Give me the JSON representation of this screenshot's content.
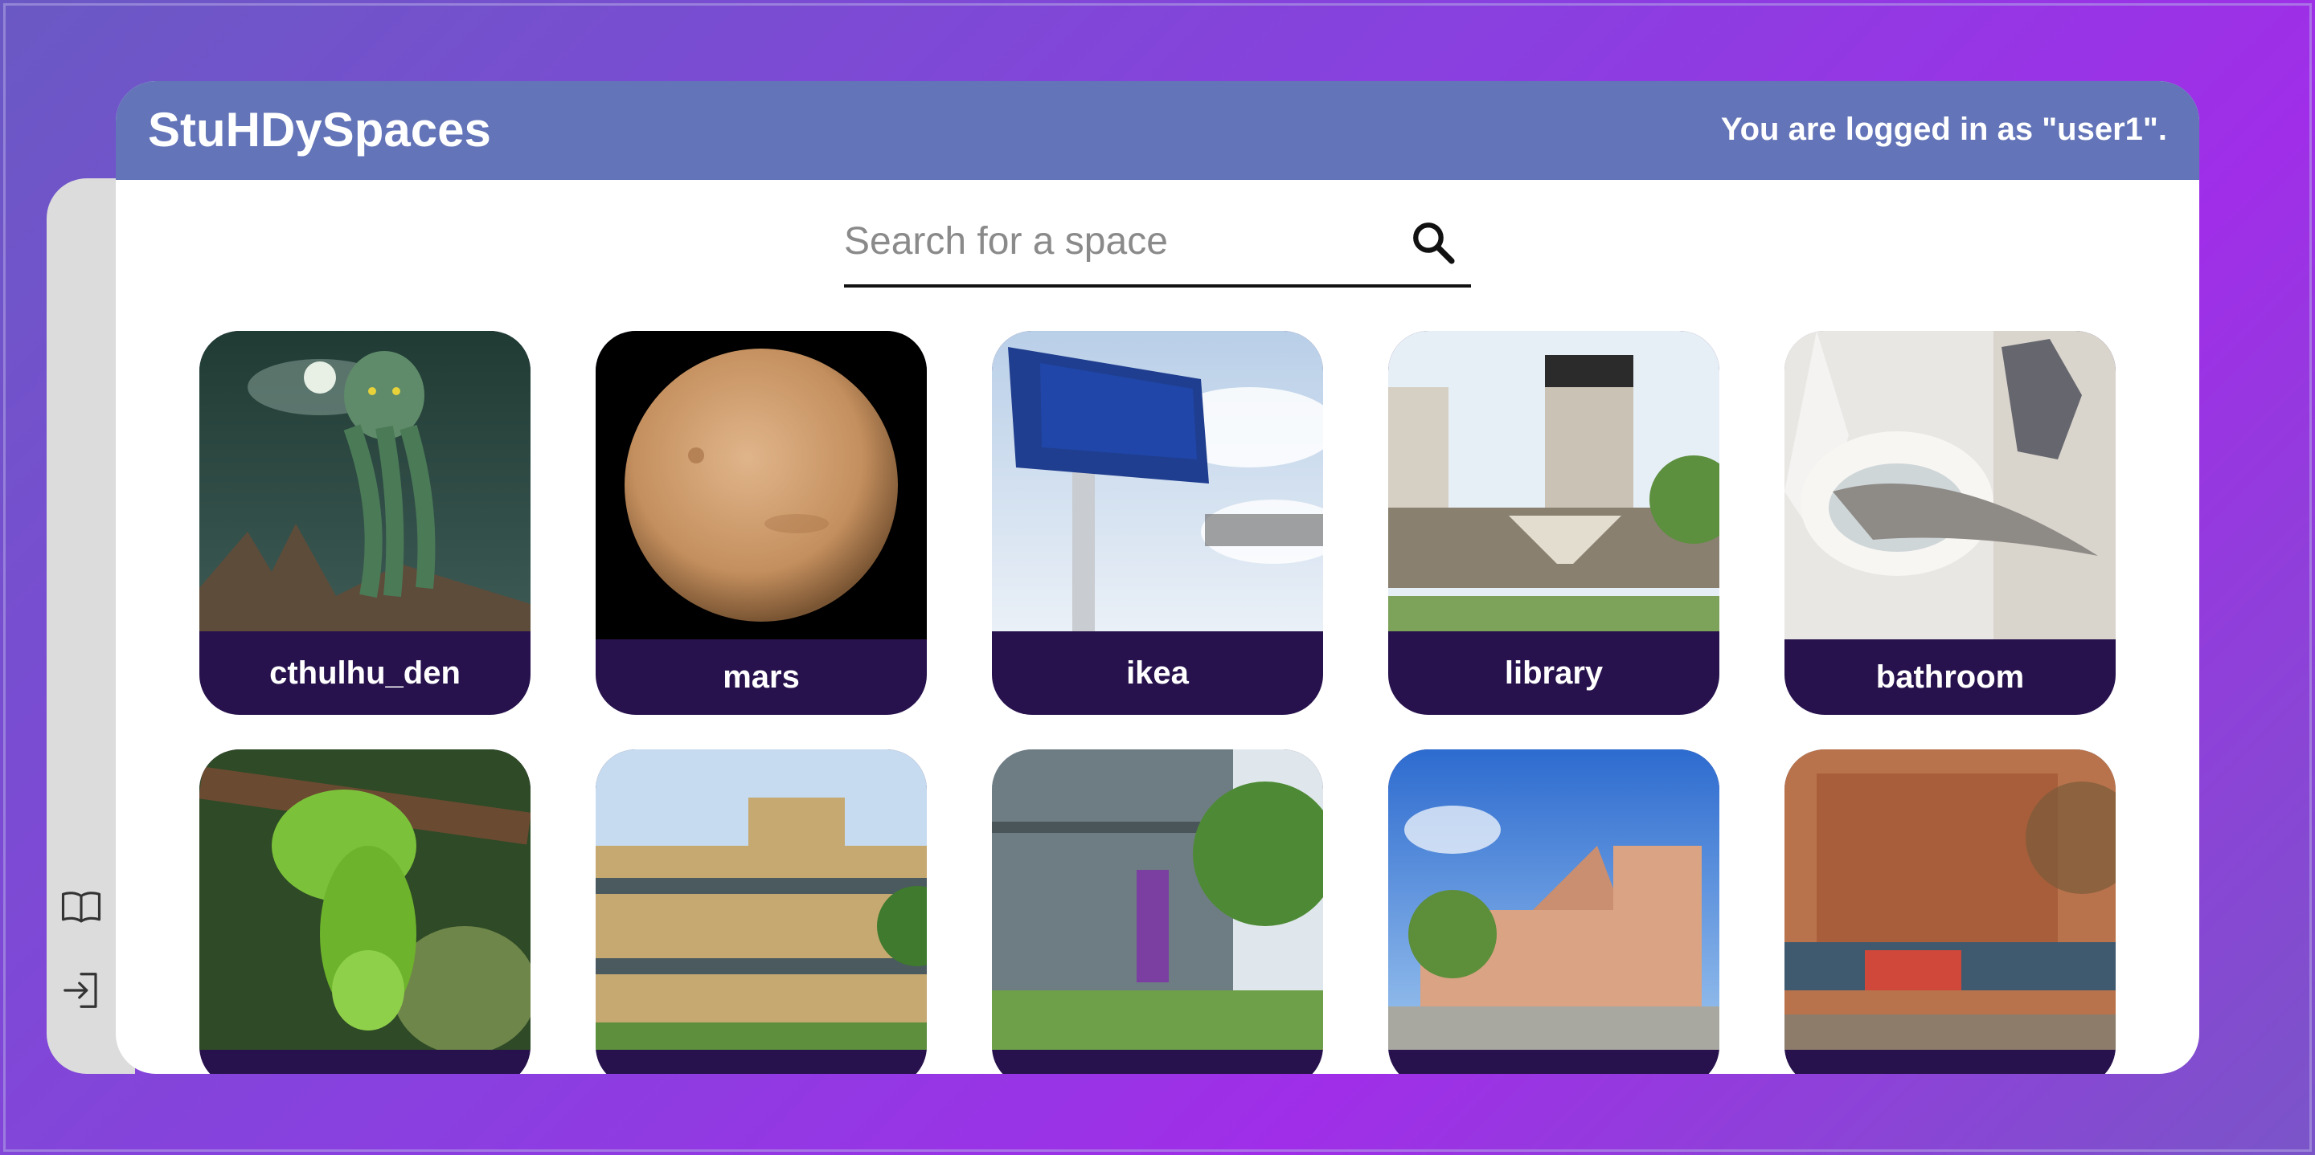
{
  "app": {
    "brand": "StuHDySpaces",
    "login_status": "You are logged in as \"user1\"."
  },
  "search": {
    "placeholder": "Search for a space",
    "value": "",
    "icon": "search-icon"
  },
  "sidebar": {
    "items": [
      {
        "icon": "book-icon"
      },
      {
        "icon": "login-icon"
      }
    ]
  },
  "spaces": [
    {
      "name": "cthulhu_den",
      "image": "cthulhu"
    },
    {
      "name": "mars",
      "image": "mars"
    },
    {
      "name": "ikea",
      "image": "ikea-sign"
    },
    {
      "name": "library",
      "image": "unsw-library"
    },
    {
      "name": "bathroom",
      "image": "shark-toilet"
    },
    {
      "name": "",
      "image": "green-snake"
    },
    {
      "name": "",
      "image": "sandstone-building"
    },
    {
      "name": "",
      "image": "glass-building"
    },
    {
      "name": "",
      "image": "timber-building"
    },
    {
      "name": "",
      "image": "brick-building"
    }
  ],
  "colors": {
    "header": "#6374b8",
    "tile_label_bg": "#27124d",
    "sidebar": "#dcdcdc"
  }
}
